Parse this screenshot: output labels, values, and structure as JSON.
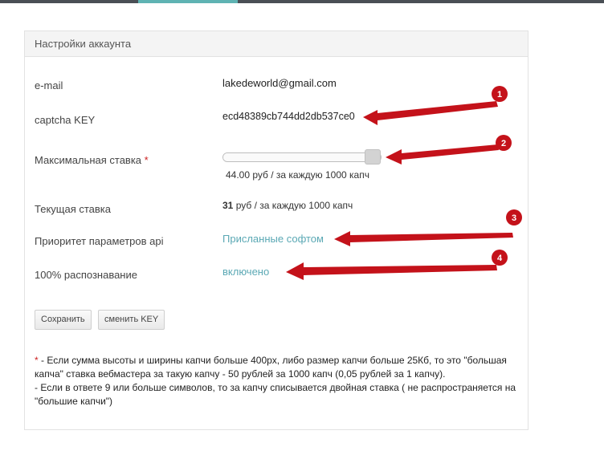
{
  "panel": {
    "title": "Настройки аккаунта"
  },
  "rows": {
    "email": {
      "label": "e-mail",
      "value": "lakedeworld@gmail.com"
    },
    "captcha": {
      "label": "captcha KEY",
      "value": "ecd48389cb744dd2db537ce0"
    },
    "max_bid": {
      "label": "Максимальная ставка",
      "required_mark": "*",
      "value_text": "44.00 руб / за каждую 1000 капч",
      "level_percent": 95
    },
    "current_bid": {
      "label": "Текущая ставка",
      "amount": "31",
      "value_text": " руб / за каждую 1000 капч"
    },
    "api_priority": {
      "label": "Приоритет параметров api",
      "value": "Присланные софтом"
    },
    "full_recognition": {
      "label": "100% распознавание",
      "value": "включено"
    }
  },
  "buttons": {
    "save": "Сохранить",
    "change_key": "сменить KEY"
  },
  "notes": {
    "star": "*",
    "line1": " - Если сумма высоты и ширины капчи больше 400px, либо размер капчи больше 25Кб, то это \"большая капча\" ставка вебмастера за такую капчу - 50 рублей за 1000 капч (0,05 рублей за 1 капчу).",
    "line2": "- Если в ответе 9 или больше символов, то за капчу списывается двойная ставка ( не распространяется на \"большие капчи\")"
  },
  "annotations": [
    "1",
    "2",
    "3",
    "4"
  ],
  "colors": {
    "annotation": "#c4121a",
    "link": "#5aa8b4",
    "required": "#cc2222"
  }
}
